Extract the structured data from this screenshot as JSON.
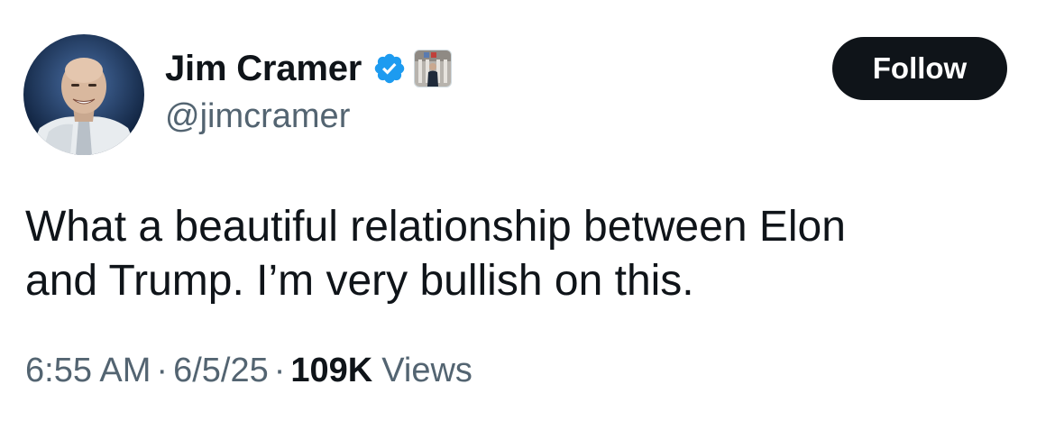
{
  "author": {
    "display_name": "Jim Cramer",
    "handle": "@jimcramer",
    "verified": true,
    "verified_color": "#1d9bf0",
    "avatar_icon": "profile-photo",
    "affiliate_badge_icon": "nyse-badge-icon"
  },
  "actions": {
    "follow_label": "Follow"
  },
  "tweet": {
    "text": "What a beautiful relationship between Elon\nand Trump. I’m very bullish on this.",
    "time": "6:55 AM",
    "date": "6/5/25",
    "separator": "·",
    "views_count": "109K",
    "views_label": "Views"
  },
  "colors": {
    "text_primary": "#0f1419",
    "text_secondary": "#536471",
    "button_bg": "#0f1419",
    "button_text": "#ffffff"
  }
}
